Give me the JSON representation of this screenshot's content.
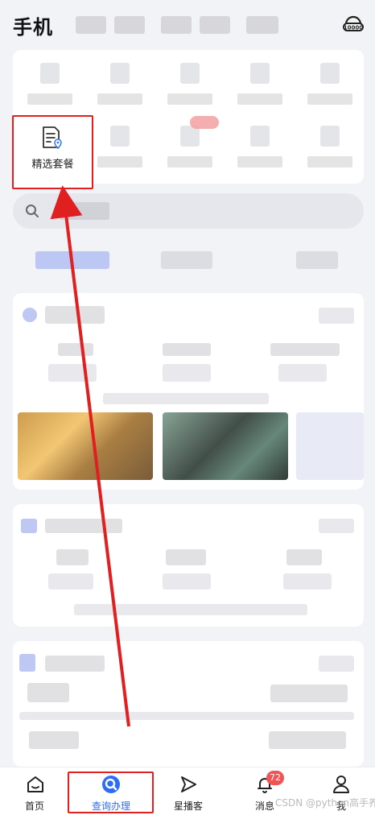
{
  "header": {
    "title": "手机",
    "service_icon": "10000-service-icon"
  },
  "quick_grid": {
    "highlighted_item": {
      "label": "精选套餐",
      "icon": "package-document-icon"
    }
  },
  "search": {
    "icon": "search-icon"
  },
  "tabbar": {
    "items": [
      {
        "label": "首页",
        "icon": "home-icon"
      },
      {
        "label": "查询办理",
        "icon": "query-icon",
        "active": true
      },
      {
        "label": "星播客",
        "icon": "send-icon"
      },
      {
        "label": "消息",
        "icon": "bell-icon",
        "badge": "72"
      },
      {
        "label": "我",
        "icon": "user-icon"
      }
    ]
  },
  "watermark": "CSDN @python高手养成",
  "colors": {
    "accent": "#2f6cf6",
    "annotation_red": "#e02020",
    "badge_red": "#f05454"
  }
}
